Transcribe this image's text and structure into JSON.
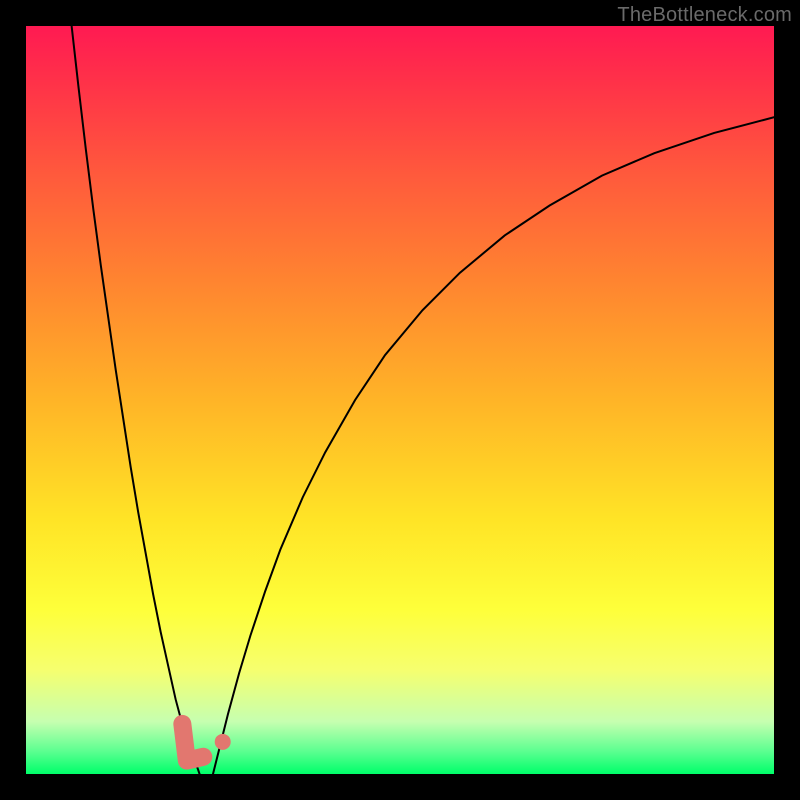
{
  "watermark": "TheBottleneck.com",
  "colors": {
    "curve": "#000000",
    "marker": "#e2776f",
    "gradient_top": "#ff1a52",
    "gradient_bottom": "#00ff6a"
  },
  "chart_data": {
    "type": "line",
    "title": "",
    "xlabel": "",
    "ylabel": "",
    "xlim": [
      0,
      100
    ],
    "ylim": [
      0,
      100
    ],
    "grid": false,
    "legend": false,
    "series": [
      {
        "name": "left-curve",
        "x": [
          6.1,
          7.0,
          8.0,
          9.0,
          10.0,
          11.0,
          12.0,
          13.0,
          14.0,
          15.0,
          16.0,
          17.0,
          18.0,
          19.0,
          20.0,
          20.8,
          21.5,
          22.0,
          22.4,
          22.7,
          23.0,
          23.2
        ],
        "y": [
          100.0,
          92.0,
          83.5,
          75.5,
          68.0,
          61.0,
          54.0,
          47.5,
          41.0,
          35.0,
          29.5,
          24.0,
          19.0,
          14.5,
          10.0,
          7.0,
          5.0,
          3.5,
          2.3,
          1.4,
          0.6,
          0.0
        ]
      },
      {
        "name": "right-curve",
        "x": [
          25.0,
          26.0,
          27.0,
          28.5,
          30.0,
          32.0,
          34.0,
          37.0,
          40.0,
          44.0,
          48.0,
          53.0,
          58.0,
          64.0,
          70.0,
          77.0,
          84.0,
          92.0,
          100.0
        ],
        "y": [
          0.0,
          4.0,
          8.0,
          13.5,
          18.5,
          24.5,
          30.0,
          37.0,
          43.0,
          50.0,
          56.0,
          62.0,
          67.0,
          72.0,
          76.0,
          80.0,
          83.0,
          85.7,
          87.8
        ]
      }
    ],
    "markers": {
      "l_shape": {
        "points_x": [
          20.9,
          21.5,
          23.7
        ],
        "points_y": [
          6.7,
          1.8,
          2.3
        ]
      },
      "dot": {
        "x": 26.3,
        "y": 4.3
      }
    }
  }
}
